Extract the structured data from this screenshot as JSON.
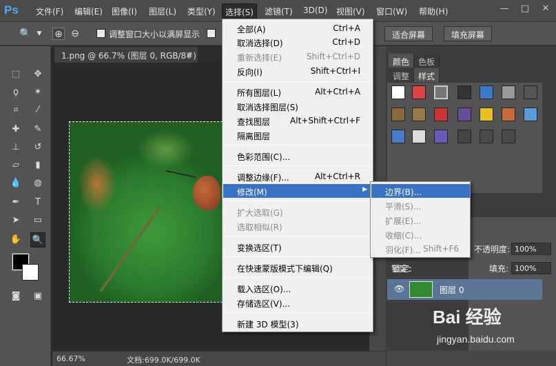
{
  "app": {
    "logo": "Ps"
  },
  "menubar": {
    "items": [
      "文件(F)",
      "编辑(E)",
      "图像(I)",
      "图层(L)",
      "类型(Y)",
      "选择(S)",
      "滤镜(T)",
      "3D(D)",
      "视图(V)",
      "窗口(W)",
      "帮助(H)"
    ]
  },
  "window_buttons": {
    "minimize": "—",
    "maximize": "□",
    "close": "✕"
  },
  "options_bar": {
    "resize_windows_label": "调整窗口大小以满屏显示",
    "fit_screen_label": "适合屏幕",
    "fill_screen_label": "填充屏幕"
  },
  "document": {
    "tab_title": "1.png @ 66.7% (图层 0, RGB/8#)",
    "tab_close": "×",
    "zoom": "66.67%",
    "doc_info": "文档:699.0K/699.0K"
  },
  "select_menu": {
    "items": [
      {
        "label": "全部(A)",
        "shortcut": "Ctrl+A",
        "state": "enabled"
      },
      {
        "label": "取消选择(D)",
        "shortcut": "Ctrl+D",
        "state": "enabled"
      },
      {
        "label": "重新选择(E)",
        "shortcut": "Shift+Ctrl+D",
        "state": "disabled"
      },
      {
        "label": "反向(I)",
        "shortcut": "Shift+Ctrl+I",
        "state": "enabled"
      },
      {
        "label": "所有图层(L)",
        "shortcut": "Alt+Ctrl+A",
        "state": "enabled"
      },
      {
        "label": "取消选择图层(S)",
        "shortcut": "",
        "state": "enabled"
      },
      {
        "label": "查找图层",
        "shortcut": "Alt+Shift+Ctrl+F",
        "state": "enabled"
      },
      {
        "label": "隔离图层",
        "shortcut": "",
        "state": "enabled"
      },
      {
        "label": "色彩范围(C)...",
        "shortcut": "",
        "state": "enabled"
      },
      {
        "label": "调整边缘(F)...",
        "shortcut": "Alt+Ctrl+R",
        "state": "enabled"
      },
      {
        "label": "修改(M)",
        "shortcut": "",
        "state": "highlighted"
      },
      {
        "label": "扩大选取(G)",
        "shortcut": "",
        "state": "disabled"
      },
      {
        "label": "选取相似(R)",
        "shortcut": "",
        "state": "disabled"
      },
      {
        "label": "变换选区(T)",
        "shortcut": "",
        "state": "enabled"
      },
      {
        "label": "在快速蒙版模式下编辑(Q)",
        "shortcut": "",
        "state": "enabled"
      },
      {
        "label": "载入选区(O)...",
        "shortcut": "",
        "state": "enabled"
      },
      {
        "label": "存储选区(V)...",
        "shortcut": "",
        "state": "enabled"
      },
      {
        "label": "新建 3D 模型(3)",
        "shortcut": "",
        "state": "enabled"
      }
    ]
  },
  "modify_submenu": {
    "items": [
      {
        "label": "边界(B)...",
        "shortcut": "",
        "state": "highlighted"
      },
      {
        "label": "平滑(S)...",
        "shortcut": "",
        "state": "disabled"
      },
      {
        "label": "扩展(E)...",
        "shortcut": "",
        "state": "disabled"
      },
      {
        "label": "收缩(C)...",
        "shortcut": "",
        "state": "disabled"
      },
      {
        "label": "羽化(F)...",
        "shortcut": "Shift+F6",
        "state": "disabled"
      }
    ]
  },
  "panels": {
    "top_tabs": [
      "颜色",
      "色板"
    ],
    "style_tabs": [
      "调整",
      "样式"
    ]
  },
  "layers": {
    "opacity_label": "不透明度:",
    "opacity_value": "100%",
    "lock_label": "锁定:",
    "fill_label": "填充:",
    "fill_value": "100%",
    "layer_name": "图层 0"
  },
  "watermark": {
    "logo": "Bai 经验",
    "url": "jingyan.baidu.com"
  },
  "colors": {
    "menu_highlight": "#3b73c4",
    "layer_selected": "#5a7596",
    "ui_dark": "#535353"
  }
}
